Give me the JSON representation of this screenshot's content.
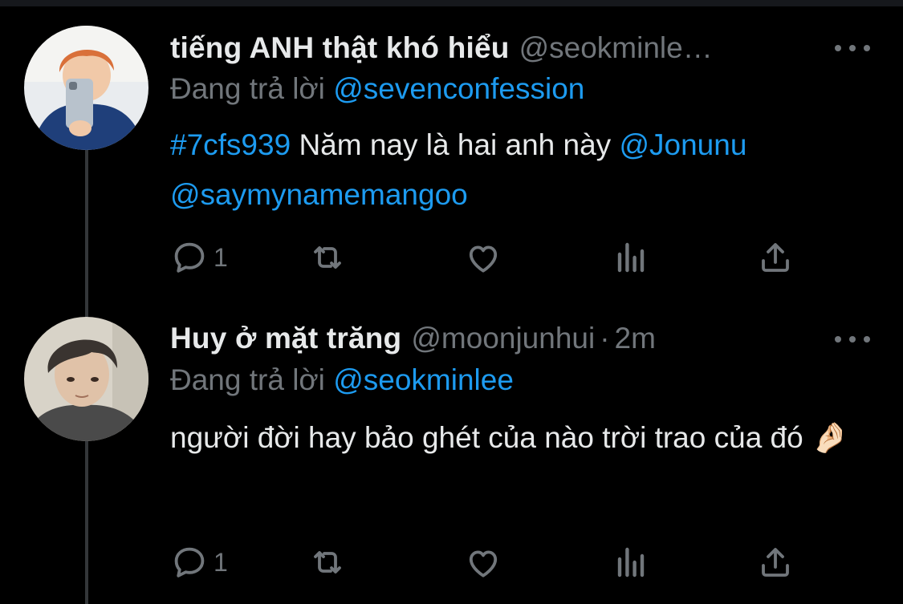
{
  "tweets": [
    {
      "display_name": "tiếng ANH thật khó hiểu",
      "handle": "@seokminle…",
      "time": "",
      "replying_label": "Đang trả lời",
      "replying_to": "@sevenconfession",
      "body": {
        "hashtag": "#7cfs939",
        "text": " Năm nay là hai anh này ",
        "mention1": "@Jonunu",
        "mention2": "@saymynamemangoo"
      },
      "reply_count": "1"
    },
    {
      "display_name": "Huy ở mặt trăng",
      "handle": "@moonjunhui",
      "separator": "·",
      "time": "2m",
      "replying_label": "Đang trả lời",
      "replying_to": "@seokminlee",
      "body": {
        "text": "người đời hay bảo ghét của nào trời trao của đó",
        "emoji": "🤌🏻"
      },
      "reply_count": "1"
    }
  ],
  "icons": [
    "reply-icon",
    "retweet-icon",
    "like-icon",
    "views-icon",
    "share-icon",
    "more-icon"
  ],
  "colors": {
    "background": "#000000",
    "text": "#e7e9ea",
    "muted": "#71767b",
    "accent": "#1d9bf0"
  }
}
